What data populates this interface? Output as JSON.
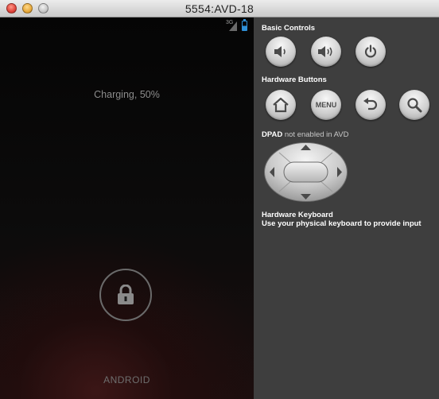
{
  "window": {
    "title": "5554:AVD-18"
  },
  "device": {
    "status_network_label": "3G",
    "charging_text": "Charging, 50%",
    "battery_level": 0.5,
    "carrier_label": "ANDROID"
  },
  "controls": {
    "basic_header": "Basic Controls",
    "hardware_header": "Hardware Buttons",
    "menu_label": "MENU",
    "dpad_header": "DPAD",
    "dpad_note": "not enabled in AVD",
    "keyboard_header": "Hardware Keyboard",
    "keyboard_note": "Use your physical keyboard to provide input"
  },
  "colors": {
    "accent_battery": "#2f8fd6",
    "panel_bg": "#3e3e3e",
    "screen_bg": "#050505"
  },
  "icons": [
    "volume-down-icon",
    "volume-up-icon",
    "power-icon",
    "home-icon",
    "back-icon",
    "search-icon",
    "lock-icon"
  ]
}
